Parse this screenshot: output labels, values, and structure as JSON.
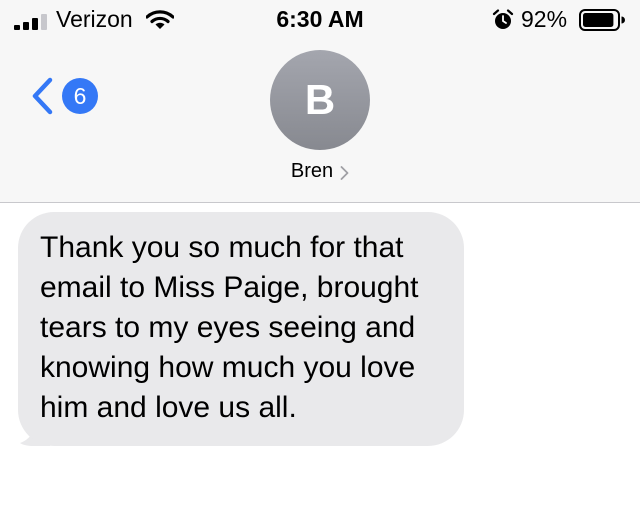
{
  "status_bar": {
    "carrier": "Verizon",
    "time": "6:30 AM",
    "battery_percent": "92%",
    "battery_level": 0.92,
    "icons": [
      "signal-icon",
      "wifi-icon",
      "alarm-icon",
      "battery-icon"
    ]
  },
  "nav": {
    "back_badge_count": "6",
    "avatar_initial": "B",
    "contact_name": "Bren"
  },
  "messages": [
    {
      "direction": "received",
      "text": "Thank you so much for that email to Miss Paige, brought tears to my eyes seeing and knowing how much you love him and love us all."
    }
  ],
  "colors": {
    "accent": "#3478f6",
    "bubble_received": "#e9e9eb",
    "header_bg": "#f7f7f7",
    "avatar_gray": "#8e9097"
  }
}
